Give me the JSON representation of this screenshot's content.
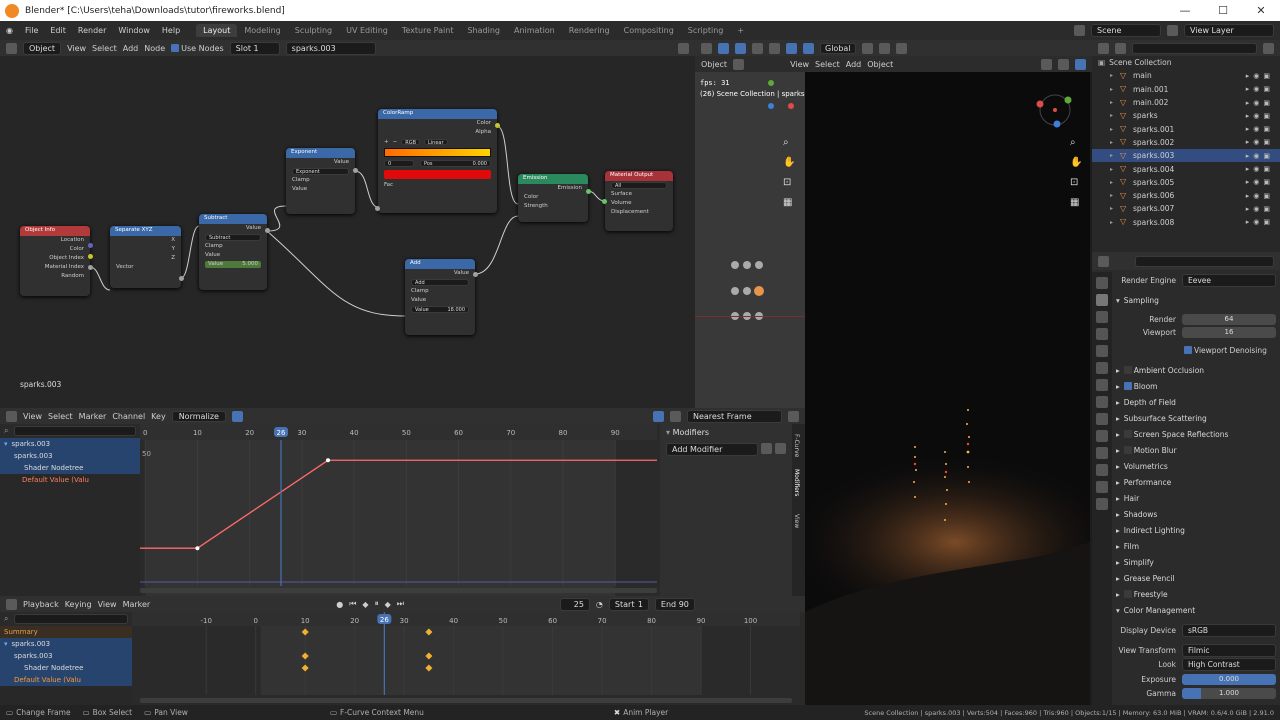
{
  "window": {
    "title": "Blender* [C:\\Users\\teha\\Downloads\\tutor\\fireworks.blend]",
    "minimize": "—",
    "maximize": "☐",
    "close": "✕"
  },
  "menu": {
    "items": [
      "File",
      "Edit",
      "Render",
      "Window",
      "Help"
    ],
    "workspaces": [
      "Layout",
      "Modeling",
      "Sculpting",
      "UV Editing",
      "Texture Paint",
      "Shading",
      "Animation",
      "Rendering",
      "Compositing",
      "Scripting"
    ],
    "add_workspace": "+",
    "scene": "Scene",
    "view_layer": "View Layer"
  },
  "node_header": {
    "mode": "Object",
    "items": [
      "View",
      "Select",
      "Add",
      "Node"
    ],
    "use_nodes": "Use Nodes",
    "slot": "Slot 1",
    "material": "sparks.003"
  },
  "node_editor": {
    "label": "sparks.003",
    "nodes": {
      "object_info": {
        "title": "Object Info",
        "outputs": [
          "Location",
          "Color",
          "Object Index",
          "Material Index",
          "Random"
        ]
      },
      "separate_xyz": {
        "title": "Separate XYZ",
        "outputs": [
          "X",
          "Y",
          "Z"
        ],
        "input": "Vector"
      },
      "subtract": {
        "title": "Subtract",
        "output": "Value",
        "operation": "Subtract",
        "clamp": "Clamp",
        "input": "Value",
        "value_label": "Value",
        "value": "5.000"
      },
      "exponent": {
        "title": "Exponent",
        "output": "Value",
        "operation": "Exponent",
        "clamp": "Clamp",
        "input": "Value"
      },
      "colorramp": {
        "title": "ColorRamp",
        "outputs": [
          "Color",
          "Alpha"
        ],
        "mode": "RGB",
        "interp": "Linear",
        "index": "0",
        "pos_label": "Pos",
        "pos": "0.000",
        "input": "Fac"
      },
      "add": {
        "title": "Add",
        "output": "Value",
        "operation": "Add",
        "clamp": "Clamp",
        "input": "Value",
        "value_label": "Value",
        "value": "18.000"
      },
      "emission": {
        "title": "Emission",
        "output": "Emission",
        "inputs": [
          "Color",
          "Strength"
        ]
      },
      "material_output": {
        "title": "Material Output",
        "target": "All",
        "inputs": [
          "Surface",
          "Volume",
          "Displacement"
        ]
      }
    }
  },
  "viewport_header": {
    "items": [
      "View",
      "Select",
      "Add",
      "Object"
    ],
    "transform": "Global",
    "object_label": "Object"
  },
  "cam_view": {
    "fps": "fps: 31",
    "label": "(26) Scene Collection | sparks.0"
  },
  "graph_editor": {
    "items": [
      "View",
      "Select",
      "Marker",
      "Channel",
      "Key"
    ],
    "normalize": "Normalize",
    "pivot": "Nearest Frame",
    "ticks": [
      "0",
      "10",
      "20",
      "30",
      "40",
      "50",
      "60",
      "70",
      "80",
      "90"
    ],
    "current_frame": "26",
    "y_tick": "50",
    "channels": [
      "sparks.003",
      "sparks.003",
      "Shader Nodetree",
      "Default Value (Valu"
    ],
    "modifiers_title": "Modifiers",
    "add_modifier": "Add Modifier",
    "side_tabs": [
      "F-Curve",
      "Modifiers",
      "View"
    ]
  },
  "curve": {
    "keyframes": [
      {
        "frame": 10,
        "value": 5
      },
      {
        "frame": 35,
        "value": 18
      }
    ],
    "x_range": [
      -1,
      98
    ],
    "y_range": [
      0,
      21
    ]
  },
  "timeline": {
    "items": [
      "Playback",
      "Keying",
      "View",
      "Marker"
    ],
    "current": "25",
    "start_label": "Start",
    "start": "1",
    "end_label": "End",
    "end": "90",
    "ticks": [
      "-10",
      "0",
      "10",
      "20",
      "30",
      "40",
      "50",
      "60",
      "70",
      "80",
      "90",
      "100"
    ],
    "current_frame": "26",
    "channels": [
      "Summary",
      "sparks.003",
      "sparks.003",
      "Shader Nodetree",
      "Default Value (Valu"
    ],
    "key_frames": [
      10,
      35
    ]
  },
  "outliner": {
    "root": "Scene Collection",
    "items": [
      {
        "name": "main",
        "selected": false
      },
      {
        "name": "main.001",
        "selected": false
      },
      {
        "name": "main.002",
        "selected": false
      },
      {
        "name": "sparks",
        "selected": false
      },
      {
        "name": "sparks.001",
        "selected": false
      },
      {
        "name": "sparks.002",
        "selected": false
      },
      {
        "name": "sparks.003",
        "selected": true
      },
      {
        "name": "sparks.004",
        "selected": false
      },
      {
        "name": "sparks.005",
        "selected": false
      },
      {
        "name": "sparks.006",
        "selected": false
      },
      {
        "name": "sparks.007",
        "selected": false
      },
      {
        "name": "sparks.008",
        "selected": false
      }
    ]
  },
  "properties": {
    "render_engine_label": "Render Engine",
    "render_engine": "Eevee",
    "sampling": "Sampling",
    "render_label": "Render",
    "render_samples": "64",
    "viewport_label": "Viewport",
    "viewport_samples": "16",
    "viewport_denoising": "Viewport Denoising",
    "panels": [
      "Ambient Occlusion",
      "Bloom",
      "Depth of Field",
      "Subsurface Scattering",
      "Screen Space Reflections",
      "Motion Blur",
      "Volumetrics",
      "Performance",
      "Hair",
      "Shadows",
      "Indirect Lighting",
      "Film",
      "Simplify",
      "Grease Pencil",
      "Freestyle"
    ],
    "color_management": "Color Management",
    "display_device_label": "Display Device",
    "display_device": "sRGB",
    "view_transform_label": "View Transform",
    "view_transform": "Filmic",
    "look_label": "Look",
    "look": "High Contrast",
    "exposure_label": "Exposure",
    "exposure": "0.000",
    "gamma_label": "Gamma",
    "gamma": "1.000"
  },
  "status": {
    "left": [
      "Change Frame",
      "Box Select",
      "Pan View"
    ],
    "context_menu": "F-Curve Context Menu",
    "anim_player": "Anim Player",
    "stats": "Scene Collection | sparks.003 | Verts:504 | Faces:960 | Tris:960 | Objects:1/15 | Memory: 63.0 MiB | VRAM: 0.6/4.0 GiB | 2.91.0"
  }
}
